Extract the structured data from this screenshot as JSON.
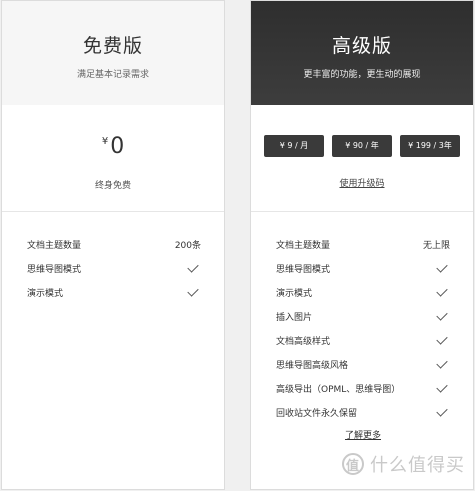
{
  "free": {
    "title": "免费版",
    "subtitle": "满足基本记录需求",
    "currency": "¥",
    "price": "0",
    "price_note": "终身免费",
    "features": [
      {
        "label": "文档主题数量",
        "value": "200条",
        "check": false
      },
      {
        "label": "思维导图模式",
        "value": "",
        "check": true
      },
      {
        "label": "演示模式",
        "value": "",
        "check": true
      }
    ]
  },
  "pro": {
    "title": "高级版",
    "subtitle": "更丰富的功能，更生动的展现",
    "options": [
      "¥ 9 / 月",
      "¥ 90 / 年",
      "¥ 199 / 3年"
    ],
    "upgrade_link": "使用升级码",
    "features": [
      {
        "label": "文档主题数量",
        "value": "无上限",
        "check": false
      },
      {
        "label": "思维导图模式",
        "value": "",
        "check": true
      },
      {
        "label": "演示模式",
        "value": "",
        "check": true
      },
      {
        "label": "插入图片",
        "value": "",
        "check": true
      },
      {
        "label": "文档高级样式",
        "value": "",
        "check": true
      },
      {
        "label": "思维导图高级风格",
        "value": "",
        "check": true
      },
      {
        "label": "高级导出（OPML、思维导图）",
        "value": "",
        "check": true
      },
      {
        "label": "回收站文件永久保留",
        "value": "",
        "check": true
      }
    ],
    "more_link": "了解更多"
  },
  "watermark": {
    "logo": "值",
    "text": "什么值得买"
  },
  "colors": {
    "pro_header": "#333333",
    "option_button": "#3a3a3a",
    "page_bg": "#f0f0f0"
  }
}
